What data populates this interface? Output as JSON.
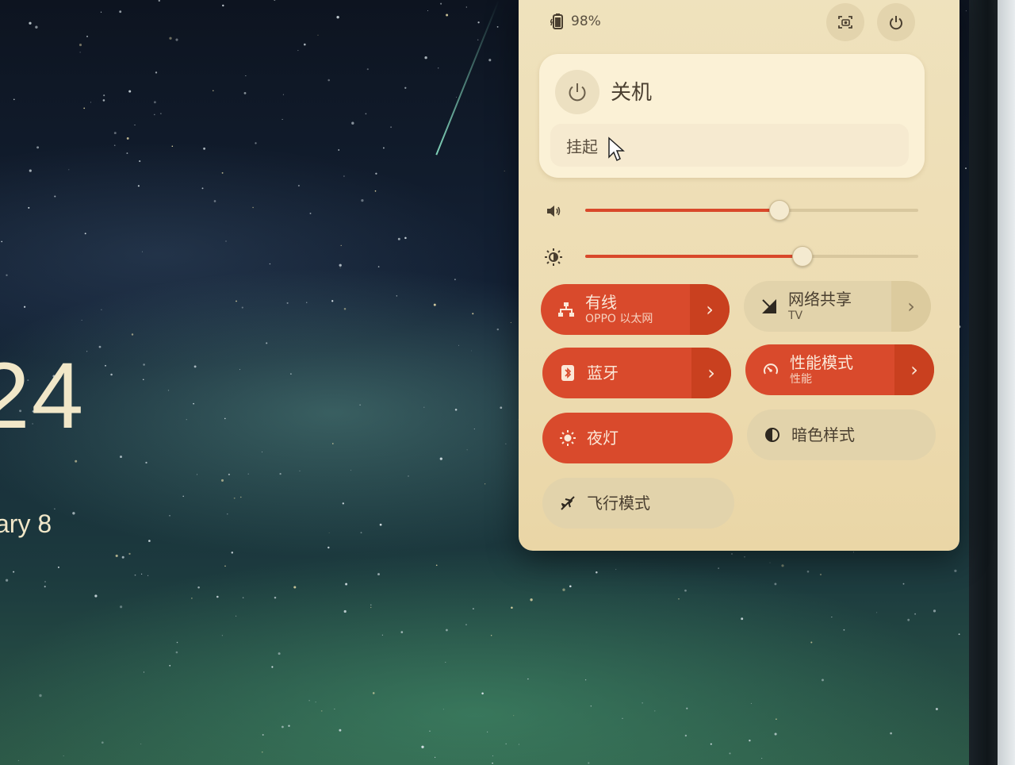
{
  "desktop": {
    "time": "24",
    "date": "ary 8"
  },
  "status": {
    "battery": "98%",
    "icons": [
      "battery-charging-icon",
      "screenshot-icon",
      "power-icon"
    ]
  },
  "power_menu": {
    "title": "关机",
    "items": [
      {
        "label": "挂起"
      }
    ]
  },
  "sliders": {
    "volume": {
      "icon": "volume-icon",
      "value": 0.58
    },
    "brightness": {
      "icon": "brightness-icon",
      "value": 0.65
    }
  },
  "tiles": {
    "wired": {
      "title": "有线",
      "subtitle": "OPPO 以太网",
      "active": true
    },
    "hotspot": {
      "title": "网络共享",
      "subtitle": "TV",
      "active": false
    },
    "bluetooth": {
      "title": "蓝牙",
      "active": true
    },
    "power_mode": {
      "title": "性能模式",
      "subtitle": "性能",
      "active": true
    },
    "night_light": {
      "title": "夜灯",
      "active": true
    },
    "dark_style": {
      "title": "暗色样式",
      "active": false
    },
    "airplane": {
      "title": "飞行模式",
      "active": false
    }
  },
  "colors": {
    "accent": "#d94a2c",
    "panel": "#efe2bd",
    "text": "#4a3f30"
  }
}
